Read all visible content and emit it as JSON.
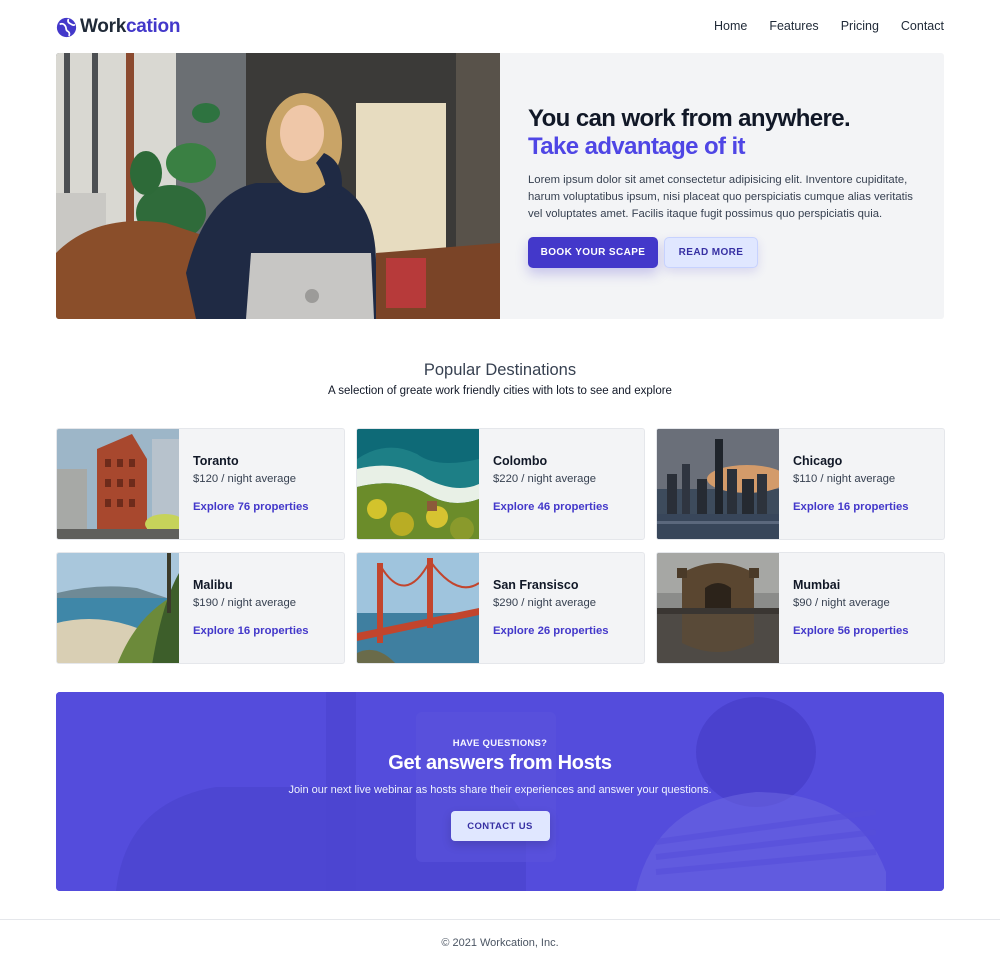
{
  "brand": {
    "name_part1": "Work",
    "name_part2": "cation",
    "accent": "#4338ca"
  },
  "nav": {
    "items": [
      {
        "label": "Home"
      },
      {
        "label": "Features"
      },
      {
        "label": "Pricing"
      },
      {
        "label": "Contact"
      }
    ]
  },
  "hero": {
    "title_line1": "You can work from anywhere.",
    "title_line2": "Take advantage of it",
    "description": "Lorem ipsum dolor sit amet consectetur adipisicing elit. Inventore cupiditate, harum voluptatibus ipsum, nisi placeat quo perspiciatis cumque alias veritatis vel voluptates amet. Facilis itaque fugit possimus quo perspiciatis quia.",
    "primary_button": "Book your scape",
    "secondary_button": "Read more"
  },
  "destinations": {
    "title": "Popular Destinations",
    "subtitle": "A selection of greate work friendly cities with lots to see and explore",
    "items": [
      {
        "city": "Toranto",
        "price": "$120 / night average",
        "link": "Explore 76 properties"
      },
      {
        "city": "Colombo",
        "price": "$220 / night average",
        "link": "Explore 46 properties"
      },
      {
        "city": "Chicago",
        "price": "$110 / night average",
        "link": "Explore 16 properties"
      },
      {
        "city": "Malibu",
        "price": "$190 / night average",
        "link": "Explore 16 properties"
      },
      {
        "city": "San Fransisco",
        "price": "$290 / night average",
        "link": "Explore 26 properties"
      },
      {
        "city": "Mumbai",
        "price": "$90 / night average",
        "link": "Explore 56 properties"
      }
    ]
  },
  "cta": {
    "eyebrow": "Have questions?",
    "title": "Get answers from Hosts",
    "text": "Join our next live webinar as hosts share their experiences and answer your questions.",
    "button": "Contact us"
  },
  "footer": {
    "text": "© 2021 Workcation, Inc."
  }
}
